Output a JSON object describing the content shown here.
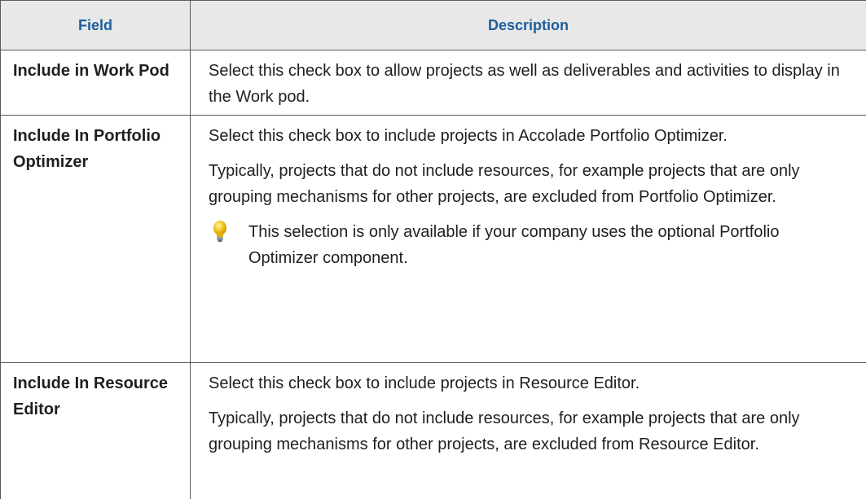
{
  "table": {
    "headers": {
      "field": "Field",
      "description": "Description"
    },
    "rows": [
      {
        "field": "Include in Work Pod",
        "paragraphs": [
          "Select this check box to allow projects as well as deliverables and activities to display in the Work pod."
        ]
      },
      {
        "field": "Include In Portfolio Optimizer",
        "paragraphs": [
          "Select this check box to include projects in Accolade Portfolio Optimizer.",
          "Typically, projects that do not include resources, for example projects that are only grouping mechanisms for other projects, are excluded from Portfolio Optimizer."
        ],
        "note": {
          "icon": "lightbulb-icon",
          "text": "This selection is only available if your company uses the optional Portfolio Optimizer component."
        }
      },
      {
        "field": "Include In Resource Editor",
        "paragraphs": [
          "Select this check box to include projects in Resource Editor.",
          "Typically, projects that do not include resources, for example projects that are only grouping mechanisms for other projects, are excluded from Resource Editor."
        ]
      }
    ]
  },
  "colors": {
    "header_background": "#e8e8e8",
    "header_text": "#1d5f9b",
    "border": "#5a5a5a",
    "body_text": "#1f1f1f",
    "bulb": "#f2c21a"
  }
}
